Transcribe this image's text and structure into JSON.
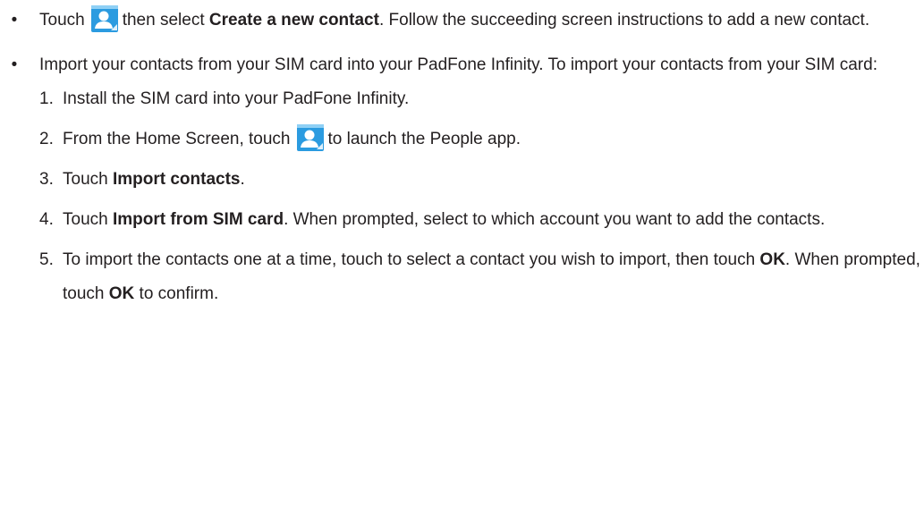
{
  "bullets": [
    {
      "marker": "•",
      "pre": "Touch",
      "icon": "people-app-icon",
      "mid": "then select",
      "bold": "Create a new contact",
      "post": ". Follow the succeeding screen instructions to add a new contact."
    },
    {
      "marker": "•",
      "text": "Import your contacts from your SIM card into your PadFone Infinity. To import your contacts from your SIM card:"
    }
  ],
  "steps": [
    {
      "num": "1.",
      "text": "Install the SIM card into your PadFone Infinity."
    },
    {
      "num": "2.",
      "pre": "From the Home Screen, touch",
      "icon": "people-app-icon",
      "post": "to launch the People app."
    },
    {
      "num": "3.",
      "pre": "Touch",
      "bold": "Import contacts",
      "post": "."
    },
    {
      "num": "4.",
      "pre": "Touch",
      "bold": "Import from SIM card",
      "post": ". When prompted, select to which account you want to add the contacts."
    },
    {
      "num": "5.",
      "pre": "To import the contacts one at a time, touch to select a contact you wish to import, then touch",
      "bold": "OK",
      "mid": ". When prompted, touch",
      "bold2": "OK",
      "post": "to confirm."
    }
  ],
  "colors": {
    "text": "#231f20",
    "icon_blue": "#2b9be0",
    "icon_light": "#8fd0f5"
  }
}
